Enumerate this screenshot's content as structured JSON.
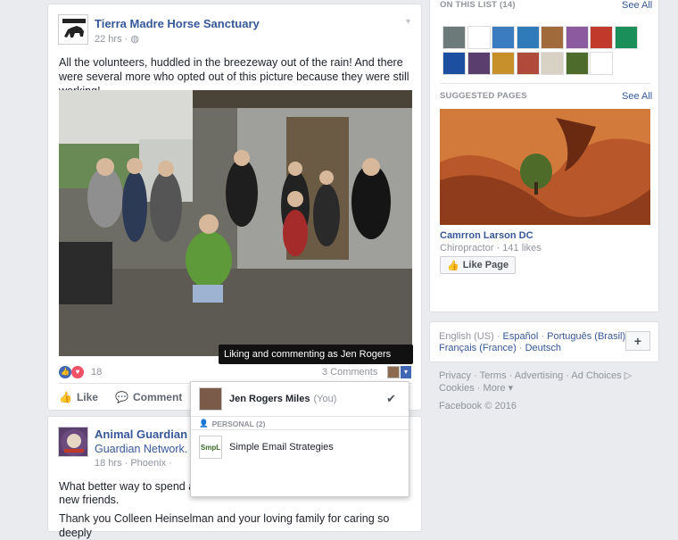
{
  "post1": {
    "page_name": "Tierra Madre Horse Sanctuary",
    "time": "22 hrs",
    "time_sep": "·",
    "text": "All the volunteers, huddled in the breezeway out of the rain! And there were several more who opted out of this picture because they were still working!",
    "reaction_count": "18",
    "comments_count": "3 Comments",
    "tooltip": "Liking and commenting as Jen Rogers Miles",
    "actions": {
      "like": "Like",
      "comment": "Comment"
    }
  },
  "identity_dropdown": {
    "current_name": "Jen Rogers Miles",
    "current_suffix": "(You)",
    "section_label": "PERSONAL (2)",
    "page_option": "Simple Email Strategies"
  },
  "post2": {
    "page_name": "Animal Guardian Ne",
    "page_name_line2": "Guardian Network.",
    "time": "18 hrs · Phoenix ·",
    "text_line1": "What better way to spend a",
    "text_line2": "new friends.",
    "text_line3": "Thank you Colleen Heinselman and your loving family for caring so deeply"
  },
  "sidebar": {
    "on_list_heading": "ON THIS LIST (14)",
    "on_list_see_all": "See All",
    "suggested_heading": "SUGGESTED PAGES",
    "suggested_see_all": "See All",
    "suggested_page_name": "Camrron Larson DC",
    "suggested_page_meta": "Chiropractor · 141 likes",
    "like_page_button": "Like Page",
    "thumb_colors": [
      "#6c7a7a",
      "#ffffff",
      "#3b7bbf",
      "#2f7ab8",
      "#a06a3a",
      "#8b5a9f",
      "#c0392b",
      "#1b8f5a",
      "#1d4fa0",
      "#5a3e6e",
      "#c8902a",
      "#b04a3a",
      "#d8d2c4",
      "#4d6b2a",
      "#ffffff"
    ]
  },
  "languages": {
    "items": [
      "English (US)",
      "Español",
      "Português (Brasil)",
      "Français (France)",
      "Deutsch"
    ],
    "separator": "·",
    "add_button": "+"
  },
  "footer": {
    "line1": [
      "Privacy",
      "Terms",
      "Advertising",
      "Ad Choices"
    ],
    "line2": [
      "Cookies",
      "More"
    ],
    "copyright": "Facebook © 2016"
  }
}
